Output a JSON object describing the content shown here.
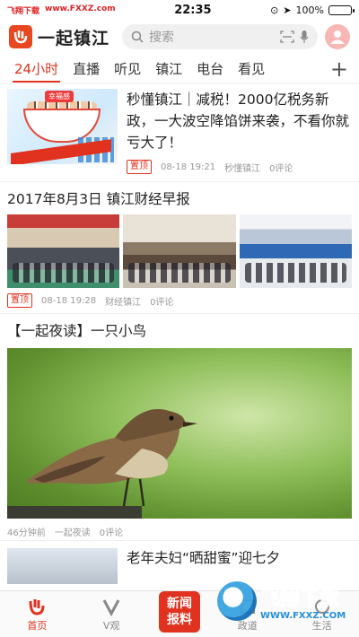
{
  "statusbar": {
    "site_label": "飞翔下载",
    "site_url": "www.FXXZ.com",
    "time": "22:35",
    "battery": "100%"
  },
  "header": {
    "app_name": "一起镇江",
    "search_placeholder": "搜索"
  },
  "tabs": [
    "24小时",
    "直播",
    "听见",
    "镇江",
    "电台",
    "看见"
  ],
  "feed": [
    {
      "title": "秒懂镇江｜减税！2000亿税务新政，一大波空降馅饼来袭，不看你就亏大了！",
      "thumb_sign": "幸福感",
      "badge": "置顶",
      "time": "08-18 19:21",
      "source": "秒懂镇江",
      "comments": "0评论"
    },
    {
      "title": "2017年8月3日 镇江财经早报",
      "badge": "置顶",
      "time": "08-18 19:28",
      "source": "财经镇江",
      "comments": "0评论"
    },
    {
      "title": "【一起夜读】一只小鸟",
      "time": "46分钟前",
      "source": "一起夜读",
      "comments": "0评论"
    },
    {
      "title": "老年夫妇“晒甜蜜”迎七夕"
    }
  ],
  "bottombar": {
    "home": "首页",
    "v": "V观",
    "report_line1": "新闻",
    "report_line2": "报料",
    "zhengjiang": "政道",
    "life": "生活"
  },
  "watermark": {
    "title": "飞翔下载",
    "url": "WWW.FXXZ.COM"
  },
  "colors": {
    "accent": "#e0321e",
    "logo": "#e8471f"
  }
}
